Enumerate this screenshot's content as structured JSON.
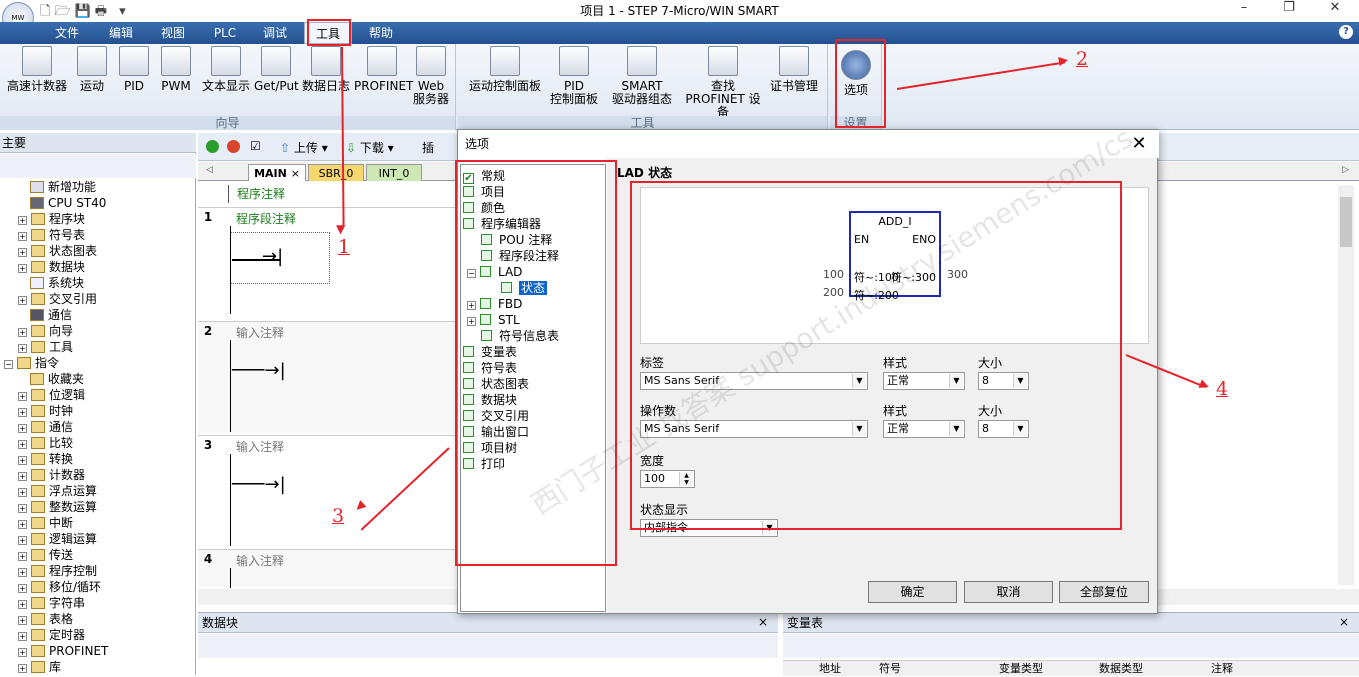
{
  "window": {
    "title": "项目 1 - STEP 7-Micro/WIN SMART",
    "minimize": "–",
    "restore": "❐",
    "close": "✕"
  },
  "menu": [
    "文件",
    "编辑",
    "视图",
    "PLC",
    "调试",
    "工具",
    "帮助"
  ],
  "help": "?",
  "ribbon": {
    "group1": {
      "label": "向导",
      "buttons": [
        "高速计数器",
        "运动",
        "PID",
        "PWM",
        "文本显示",
        "Get/Put",
        "数据日志",
        "PROFINET",
        "Web\n服务器"
      ]
    },
    "group2": {
      "label": "工具",
      "buttons": [
        "运动控制面板",
        "PID\n控制面板",
        "SMART\n驱动器组态",
        "查找\nPROFINET 设备",
        "证书管理"
      ]
    },
    "group3": {
      "label": "设置",
      "buttons": [
        "选项"
      ]
    }
  },
  "left_tree": {
    "header": "主要",
    "items": [
      "新增功能",
      "CPU ST40",
      "程序块",
      "符号表",
      "状态图表",
      "数据块",
      "系统块",
      "交叉引用",
      "通信",
      "向导",
      "工具",
      "指令",
      "收藏夹",
      "位逻辑",
      "时钟",
      "通信",
      "比较",
      "转换",
      "计数器",
      "浮点运算",
      "整数运算",
      "中断",
      "逻辑运算",
      "传送",
      "程序控制",
      "移位/循环",
      "字符串",
      "表格",
      "定时器",
      "PROFINET",
      "库"
    ]
  },
  "editor": {
    "upload": "上传",
    "download": "下载",
    "insert": "插",
    "tabs": [
      "MAIN",
      "SBR_0",
      "INT_0"
    ],
    "program_comment": "程序注释",
    "networks": [
      {
        "num": "1",
        "comment": "程序段注释"
      },
      {
        "num": "2",
        "comment": "输入注释"
      },
      {
        "num": "3",
        "comment": "输入注释"
      },
      {
        "num": "4",
        "comment": "输入注释"
      }
    ]
  },
  "datablock": {
    "title": "数据块"
  },
  "vartable": {
    "title": "变量表",
    "columns": [
      "地址",
      "符号",
      "变量类型",
      "数据类型",
      "注释"
    ]
  },
  "dialog": {
    "title": "选项",
    "close": "✕",
    "tree": [
      "常规",
      "项目",
      "颜色",
      "程序编辑器",
      "POU 注释",
      "程序段注释",
      "LAD",
      "状态",
      "FBD",
      "STL",
      "符号信息表",
      "变量表",
      "符号表",
      "状态图表",
      "数据块",
      "交叉引用",
      "输出窗口",
      "项目树",
      "打印"
    ],
    "section": "LAD 状态",
    "preview": {
      "block": "ADD_I",
      "en": "EN",
      "eno": "ENO",
      "in1_val": "100",
      "in1": "符~:100",
      "out": "符~:300",
      "out_val": "300",
      "in2_val": "200",
      "in2": "符~:200"
    },
    "label_row": {
      "label": "标签",
      "font": "MS Sans Serif",
      "style_label": "样式",
      "style": "正常",
      "size_label": "大小",
      "size": "8"
    },
    "operand_row": {
      "label": "操作数",
      "font": "MS Sans Serif",
      "style_label": "样式",
      "style": "正常",
      "size_label": "大小",
      "size": "8"
    },
    "width_label": "宽度",
    "width": "100",
    "status_label": "状态显示",
    "status": "内部指令",
    "buttons": {
      "ok": "确定",
      "cancel": "取消",
      "reset": "全部复位"
    }
  },
  "annotations": [
    "1",
    "2",
    "3",
    "4"
  ],
  "watermark": "西门子工业 找答案 support.industry.siemens.com/cs"
}
